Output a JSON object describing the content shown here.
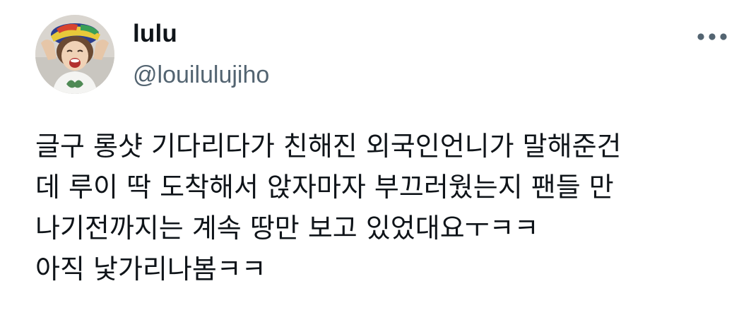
{
  "author": {
    "display_name": "lulu",
    "handle": "@louilulujiho"
  },
  "menu": {
    "icon": "more-horizontal-icon"
  },
  "tweet": {
    "lines": [
      "글구 롱샷 기다리다가 친해진 외국인언니가 말해준건",
      "데 루이 딱 도착해서 앉자마자 부끄러웠는지 팬들 만",
      "나기전까지는 계속 땅만 보고 있었대요ㅜㅋㅋ",
      "아직 낯가리나봄ㅋㅋ"
    ]
  },
  "colors": {
    "text_primary": "#0f1419",
    "text_secondary": "#536471",
    "background": "#ffffff"
  }
}
